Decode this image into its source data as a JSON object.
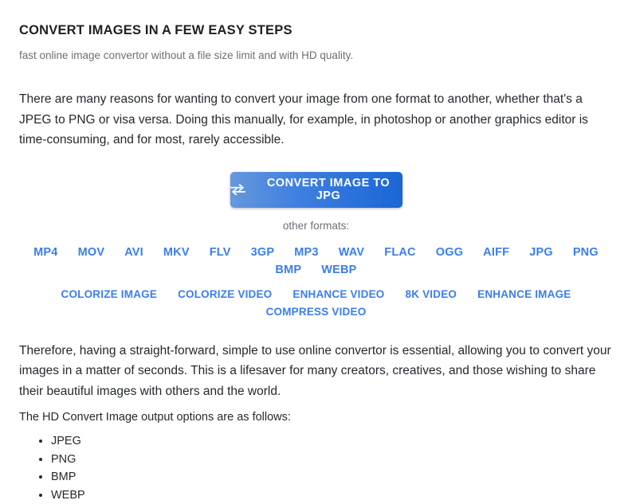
{
  "header": {
    "title": "CONVERT IMAGES IN A FEW EASY STEPS",
    "subtitle": "fast online image convertor without a file size limit and with HD quality."
  },
  "intro_paragraph": "There are many reasons for wanting to convert your image from one format to another, whether that's a JPEG to PNG or visa versa. Doing this manually, for example, in photoshop or another graphics editor is time-consuming, and for most, rarely accessible.",
  "cta": {
    "label": "CONVERT IMAGE TO JPG",
    "icon": "swap-arrows-icon",
    "gradient_start": "#6698dd",
    "gradient_end": "#1a66d6",
    "text_color": "#ffffff"
  },
  "other_formats": {
    "label": "other formats:",
    "link_color": "#3b7ded",
    "formats": [
      "MP4",
      "MOV",
      "AVI",
      "MKV",
      "FLV",
      "3GP",
      "MP3",
      "WAV",
      "FLAC",
      "OGG",
      "AIFF",
      "JPG",
      "PNG",
      "BMP",
      "WEBP"
    ],
    "tools": [
      "COLORIZE IMAGE",
      "COLORIZE VIDEO",
      "ENHANCE VIDEO",
      "8K VIDEO",
      "ENHANCE IMAGE",
      "COMPRESS VIDEO"
    ]
  },
  "closing_paragraph": "Therefore, having a straight-forward, simple to use online convertor is essential, allowing you to convert your images in a matter of seconds. This is a lifesaver for many creators, creatives, and those wishing to share their beautiful images with others and the world.",
  "output_options": {
    "intro": "The HD Convert Image output options are as follows:",
    "items": [
      "JPEG",
      "PNG",
      "BMP",
      "WEBP"
    ]
  }
}
